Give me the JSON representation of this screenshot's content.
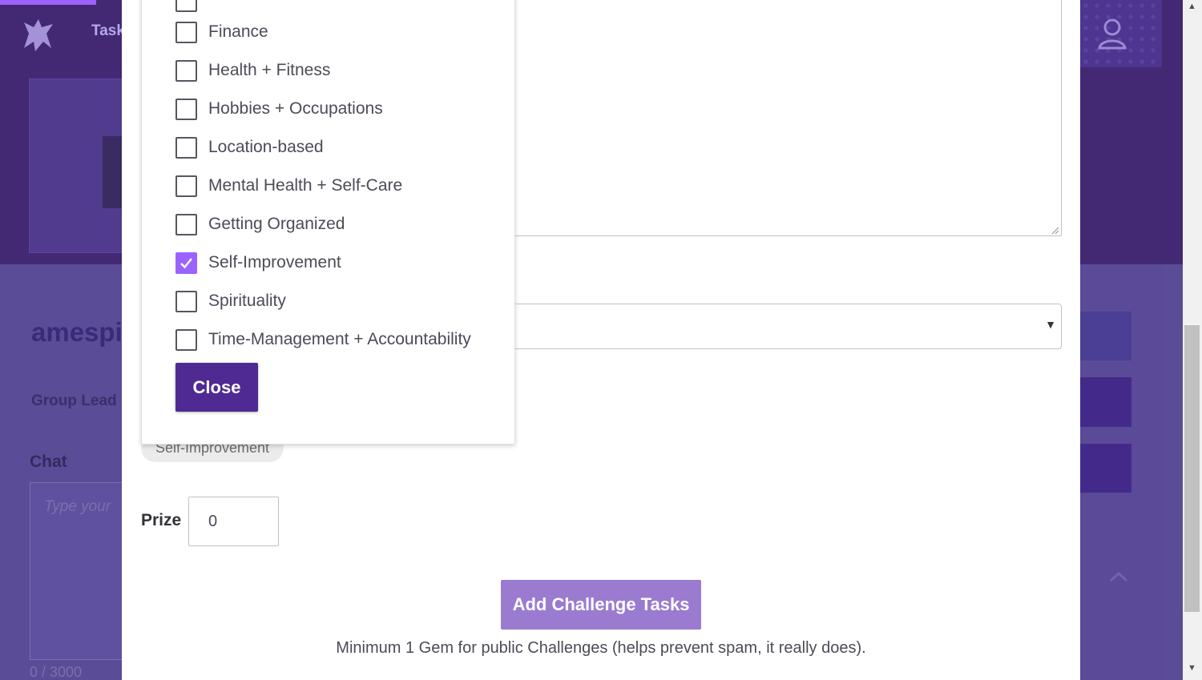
{
  "background": {
    "nav_tasks": "Task",
    "group_name": "amespir",
    "group_leader_label": "Group Lead",
    "chat_heading": "Chat",
    "chat_placeholder": "Type your",
    "chat_count": "0 / 3000"
  },
  "modal": {
    "tag_chip": "Self-Improvement",
    "prize_label": "Prize",
    "prize_value": "0",
    "add_tasks_label": "Add Challenge Tasks",
    "min_gem_note": "Minimum 1 Gem for public Challenges (helps prevent spam, it really does)."
  },
  "categories": {
    "items": [
      {
        "label": "",
        "checked": false
      },
      {
        "label": "Finance",
        "checked": false
      },
      {
        "label": "Health + Fitness",
        "checked": false
      },
      {
        "label": "Hobbies + Occupations",
        "checked": false
      },
      {
        "label": "Location-based",
        "checked": false
      },
      {
        "label": "Mental Health + Self-Care",
        "checked": false
      },
      {
        "label": "Getting Organized",
        "checked": false
      },
      {
        "label": "Self-Improvement",
        "checked": true
      },
      {
        "label": "Spirituality",
        "checked": false
      },
      {
        "label": "Time-Management + Accountability",
        "checked": false
      }
    ],
    "close_label": "Close"
  },
  "colors": {
    "brand_purple": "#432874",
    "checkbox_accent": "#9a62ff",
    "close_button": "#4f2a93",
    "add_tasks_button": "#9a7bd0"
  },
  "icons": [
    "gryphon-logo-icon",
    "user-icon",
    "chevron-up-icon",
    "checkmark-icon",
    "caret-down-icon",
    "resize-grip-icon"
  ]
}
